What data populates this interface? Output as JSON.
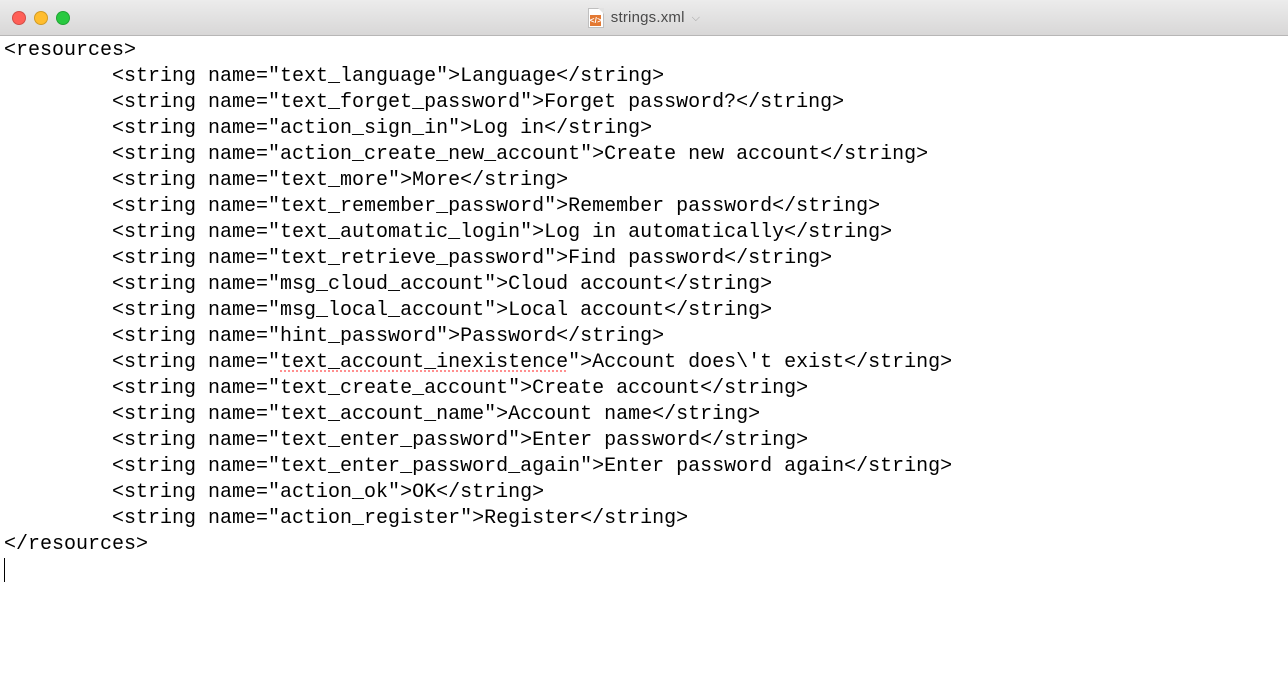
{
  "window": {
    "filename": "strings.xml",
    "dropdown_glyph": "⌵",
    "file_badge": "</>"
  },
  "code": {
    "root_open": "<resources>",
    "root_close": "</resources>",
    "tag": "string",
    "attr": "name",
    "entries": [
      {
        "key": "text_language",
        "value": "Language",
        "spellerr": false
      },
      {
        "key": "text_forget_password",
        "value": "Forget password?",
        "spellerr": false
      },
      {
        "key": "action_sign_in",
        "value": "Log in",
        "spellerr": false
      },
      {
        "key": "action_create_new_account",
        "value": "Create new account",
        "spellerr": false
      },
      {
        "key": "text_more",
        "value": "More",
        "spellerr": false
      },
      {
        "key": "text_remember_password",
        "value": "Remember password",
        "spellerr": false
      },
      {
        "key": "text_automatic_login",
        "value": "Log in automatically",
        "spellerr": false
      },
      {
        "key": "text_retrieve_password",
        "value": "Find password",
        "spellerr": false
      },
      {
        "key": "msg_cloud_account",
        "value": "Cloud account",
        "spellerr": false
      },
      {
        "key": "msg_local_account",
        "value": "Local account",
        "spellerr": false
      },
      {
        "key": "hint_password",
        "value": "Password",
        "spellerr": false
      },
      {
        "key": "text_account_inexistence",
        "value": "Account does\\'t exist",
        "spellerr": true
      },
      {
        "key": "text_create_account",
        "value": "Create account",
        "spellerr": false
      },
      {
        "key": "text_account_name",
        "value": "Account name",
        "spellerr": false
      },
      {
        "key": "text_enter_password",
        "value": "Enter password",
        "spellerr": false
      },
      {
        "key": "text_enter_password_again",
        "value": "Enter password again",
        "spellerr": false
      },
      {
        "key": "action_ok",
        "value": "OK",
        "spellerr": false
      },
      {
        "key": "action_register",
        "value": "Register",
        "spellerr": false
      }
    ]
  }
}
